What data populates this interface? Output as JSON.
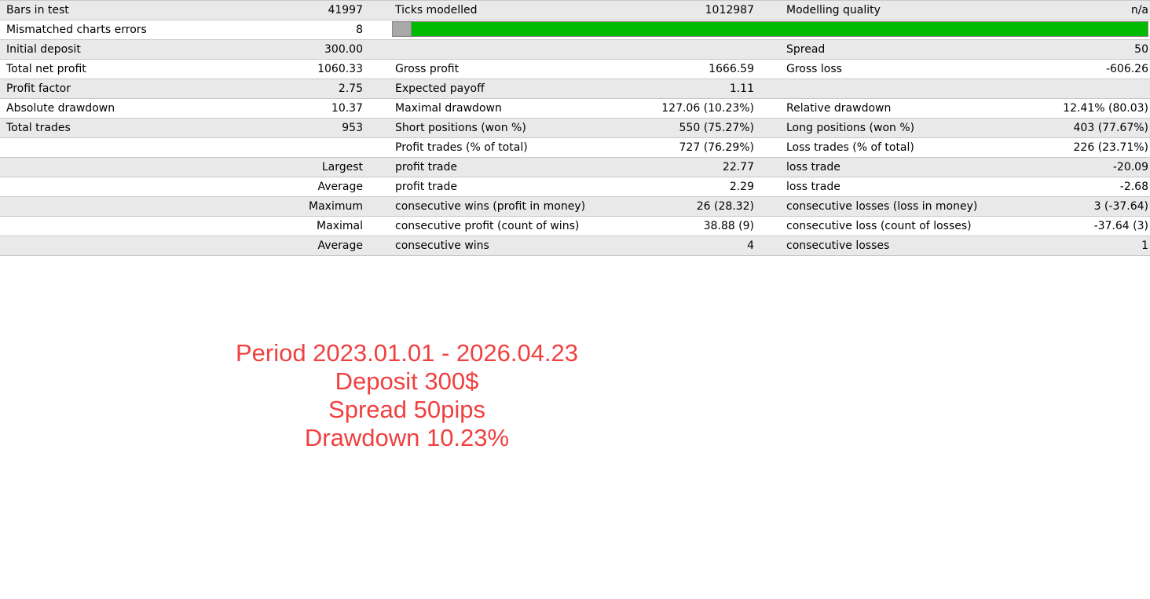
{
  "report": {
    "rows": [
      {
        "l1": "Bars in test",
        "v1": "41997",
        "l2": "Ticks modelled",
        "v2": "1012987",
        "l3": "Modelling quality",
        "v3": "n/a"
      },
      {
        "l1": "Mismatched charts errors",
        "v1": "8"
      },
      {
        "l1": "Initial deposit",
        "v1": "300.00",
        "l2": "",
        "v2": "",
        "l3": "Spread",
        "v3": "50"
      },
      {
        "l1": "Total net profit",
        "v1": "1060.33",
        "l2": "Gross profit",
        "v2": "1666.59",
        "l3": "Gross loss",
        "v3": "-606.26"
      },
      {
        "l1": "Profit factor",
        "v1": "2.75",
        "l2": "Expected payoff",
        "v2": "1.11",
        "l3": "",
        "v3": ""
      },
      {
        "l1": "Absolute drawdown",
        "v1": "10.37",
        "l2": "Maximal drawdown",
        "v2": "127.06 (10.23%)",
        "l3": "Relative drawdown",
        "v3": "12.41% (80.03)"
      },
      {
        "l1": "Total trades",
        "v1": "953",
        "l2": "Short positions (won %)",
        "v2": "550 (75.27%)",
        "l3": "Long positions (won %)",
        "v3": "403 (77.67%)"
      },
      {
        "l1": "",
        "v1": "",
        "l2": "Profit trades (% of total)",
        "v2": "727 (76.29%)",
        "l3": "Loss trades (% of total)",
        "v3": "226 (23.71%)"
      },
      {
        "l1": "",
        "v1": "Largest",
        "l2": "profit trade",
        "v2": "22.77",
        "l3": "loss trade",
        "v3": "-20.09"
      },
      {
        "l1": "",
        "v1": "Average",
        "l2": "profit trade",
        "v2": "2.29",
        "l3": "loss trade",
        "v3": "-2.68"
      },
      {
        "l1": "",
        "v1": "Maximum",
        "l2": "consecutive wins (profit in money)",
        "v2": "26 (28.32)",
        "l3": "consecutive losses (loss in money)",
        "v3": "3 (-37.64)"
      },
      {
        "l1": "",
        "v1": "Maximal",
        "l2": "consecutive profit (count of wins)",
        "v2": "38.88 (9)",
        "l3": "consecutive loss (count of losses)",
        "v3": "-37.64 (3)"
      },
      {
        "l1": "",
        "v1": "Average",
        "l2": "consecutive wins",
        "v2": "4",
        "l3": "consecutive losses",
        "v3": "1"
      }
    ],
    "quality_bar": {
      "unmodelled_fraction": 0.025,
      "modelled_color": "#00bb00",
      "unmodelled_color": "#a8a8a8"
    },
    "row_shade_color": "#e9e9e9"
  },
  "annotation": {
    "color": "#f04040",
    "lines": [
      "Period 2023.01.01 - 2026.04.23",
      "Deposit 300$",
      "Spread 50pips",
      "Drawdown 10.23%"
    ]
  }
}
